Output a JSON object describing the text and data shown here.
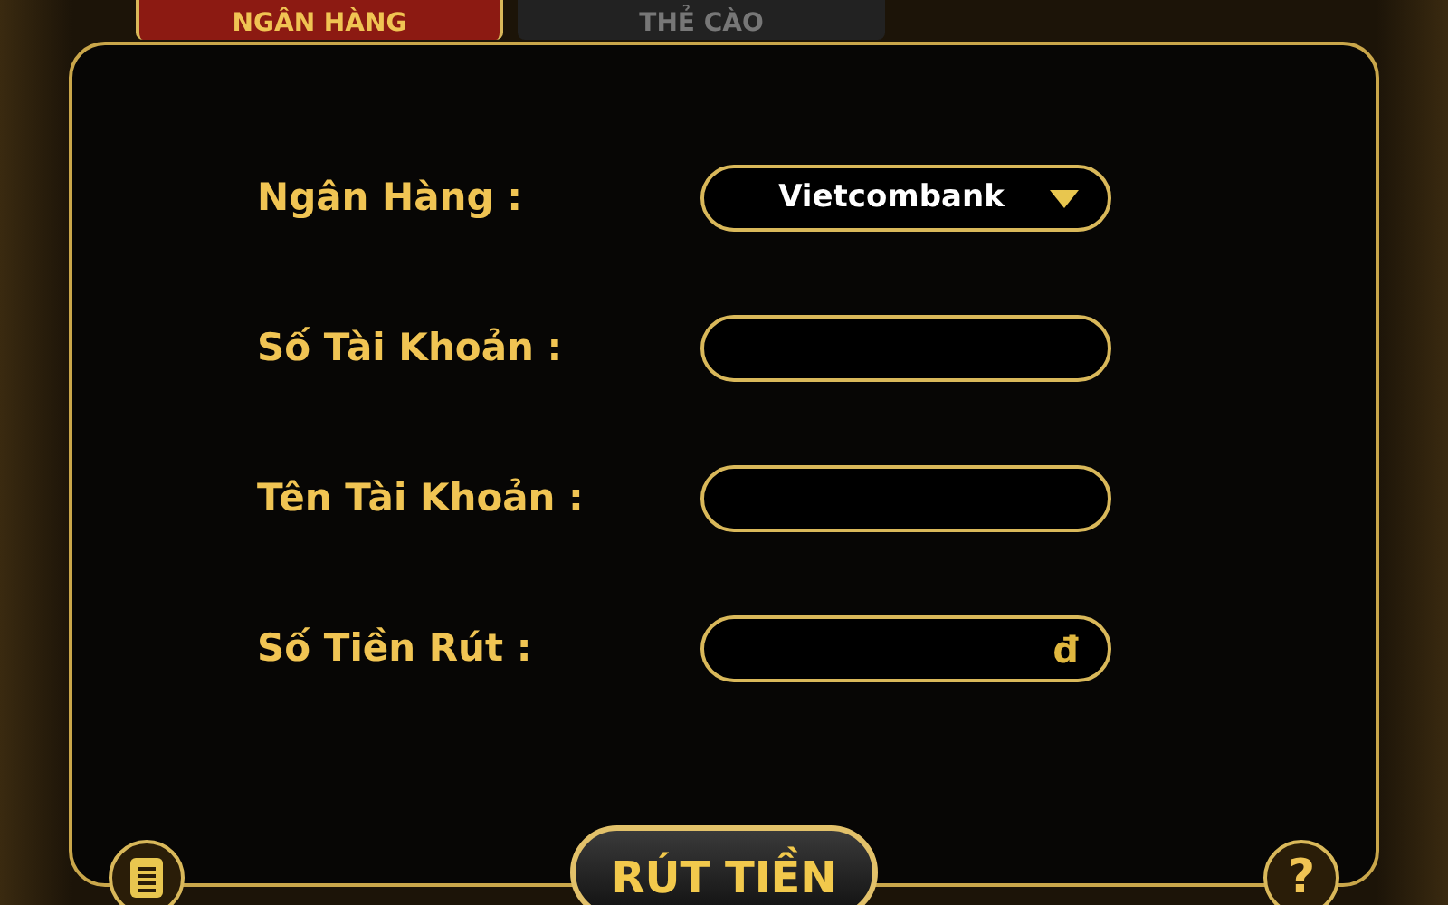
{
  "tabs": [
    {
      "label": "NGÂN HÀNG",
      "selected": true
    },
    {
      "label": "THẺ CÀO",
      "selected": false
    }
  ],
  "fields": [
    {
      "kind": "select",
      "label": "Ngân Hàng :",
      "value": "Vietcombank"
    },
    {
      "kind": "text",
      "label": "Số Tài Khoản :"
    },
    {
      "kind": "text",
      "label": "Tên Tài Khoản :"
    },
    {
      "kind": "text",
      "label": "Số Tiền Rút :",
      "suffix": "đ"
    }
  ],
  "submit": {
    "label": "RÚT TIỀN"
  },
  "help": {
    "label": "?"
  }
}
